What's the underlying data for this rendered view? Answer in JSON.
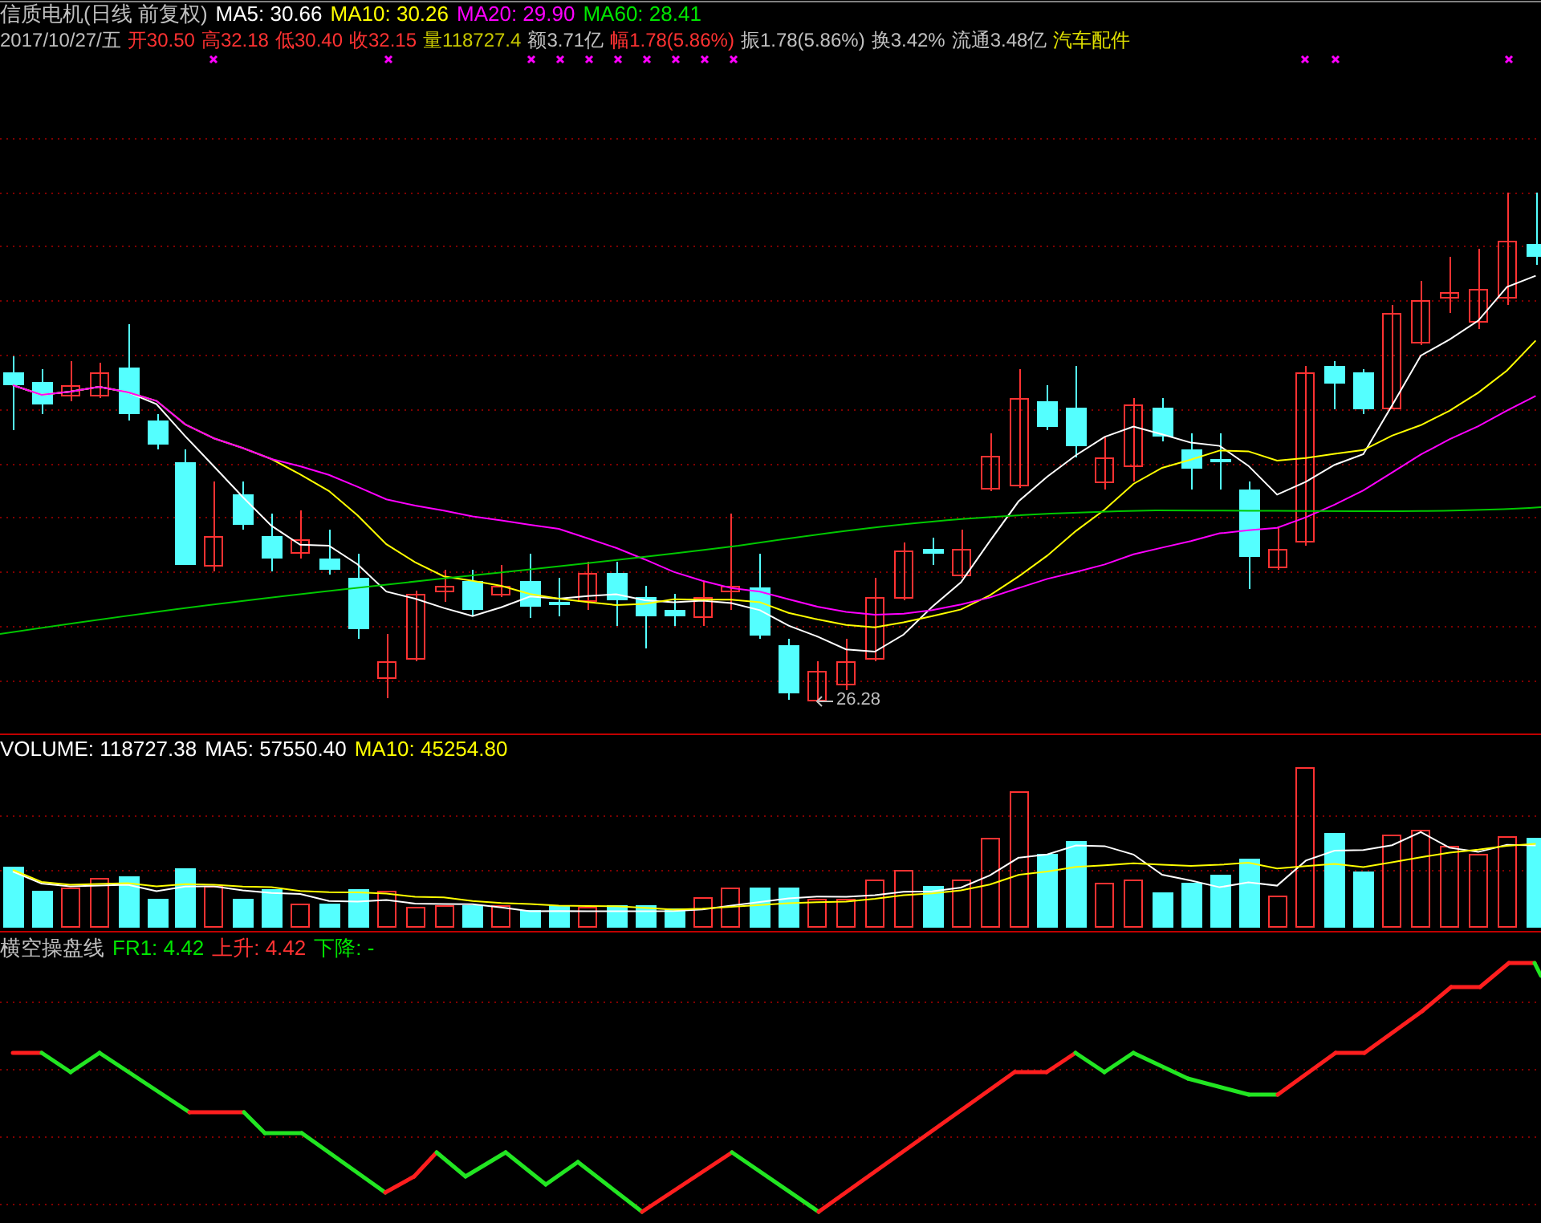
{
  "title": {
    "stock": "信质电机(日线 前复权)",
    "ma": [
      {
        "label": "MA5: 30.66",
        "color": "#ffffff"
      },
      {
        "label": "MA10: 30.26",
        "color": "#ffff00"
      },
      {
        "label": "MA20: 29.90",
        "color": "#ff00ff"
      },
      {
        "label": "MA60: 28.41",
        "color": "#00e600"
      }
    ]
  },
  "quote": {
    "date": "2017/10/27/五",
    "items": [
      {
        "label": "开30.50",
        "color": "#ff3232"
      },
      {
        "label": "高32.18",
        "color": "#ff3232"
      },
      {
        "label": "低30.40",
        "color": "#ff3232"
      },
      {
        "label": "收32.15",
        "color": "#ff3232"
      },
      {
        "label": "量118727.4",
        "color": "#c8c800"
      },
      {
        "label": "额3.71亿",
        "color": "#c0c0c0"
      },
      {
        "label": "幅1.78(5.86%)",
        "color": "#ff3232"
      },
      {
        "label": "振1.78(5.86%)",
        "color": "#c0c0c0"
      },
      {
        "label": "换3.42%",
        "color": "#c0c0c0"
      },
      {
        "label": "流通3.48亿",
        "color": "#c0c0c0"
      },
      {
        "label": "汽车配件",
        "color": "#e0e000"
      }
    ]
  },
  "price_chart": {
    "low_label": "26.28"
  },
  "volume": {
    "items": [
      {
        "label": "VOLUME: 118727.38",
        "color": "#ffffff"
      },
      {
        "label": "MA5: 57550.40",
        "color": "#ffffff"
      },
      {
        "label": "MA10: 45254.80",
        "color": "#ffff00"
      }
    ]
  },
  "indicator": {
    "name": "横空操盘线",
    "items": [
      {
        "label": "FR1: 4.42",
        "color": "#00e600"
      },
      {
        "label": "上升: 4.42",
        "color": "#ff3232"
      },
      {
        "label": "下降: -",
        "color": "#00e600"
      }
    ]
  }
}
